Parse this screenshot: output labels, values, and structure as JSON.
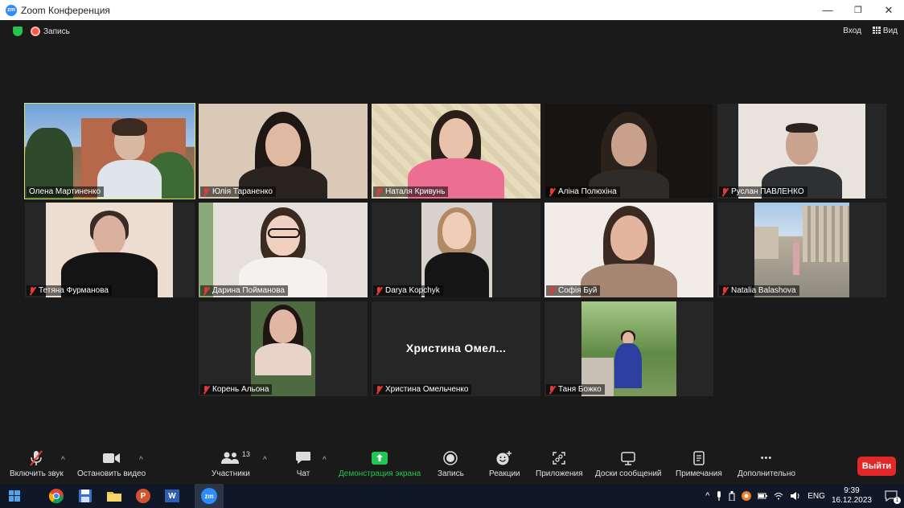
{
  "window": {
    "title": "Zoom Конференция",
    "logo_text": "zm",
    "minimize": "—",
    "restore": "❐",
    "close": "✕"
  },
  "meeting_top": {
    "recording_label": "Запись",
    "signin_label": "Вход",
    "view_label": "Вид"
  },
  "participants": [
    {
      "name": "Олена Мартиненко",
      "muted": false,
      "active": true
    },
    {
      "name": "Юлія Тараненко",
      "muted": true
    },
    {
      "name": "Наталя Кривунь",
      "muted": true
    },
    {
      "name": "Аліна Полюхіна",
      "muted": true
    },
    {
      "name": "Руслан ПАВЛЕНКО",
      "muted": true
    },
    {
      "name": "Тетяна Фурманова",
      "muted": true
    },
    {
      "name": "Дарина Пойманова",
      "muted": true
    },
    {
      "name": "Darya Kopchyk",
      "muted": true
    },
    {
      "name": "Софія Буй",
      "muted": true
    },
    {
      "name": "Natalia Balashova",
      "muted": true
    },
    {
      "name": "Корень Альона",
      "muted": true
    },
    {
      "name": "Христина Омельченко",
      "muted": true,
      "video_off_label": "Христина Омел..."
    },
    {
      "name": "Таня Божко",
      "muted": true
    }
  ],
  "toolbar": {
    "unmute_label": "Включить звук",
    "stop_video_label": "Остановить видео",
    "participants_label": "Участники",
    "participants_count": "13",
    "chat_label": "Чат",
    "share_label": "Демонстрация экрана",
    "record_label": "Запись",
    "reactions_label": "Реакции",
    "apps_label": "Приложения",
    "whiteboards_label": "Доски сообщений",
    "notes_label": "Примечания",
    "more_label": "Дополнительно",
    "more_dots": "•••",
    "leave_label": "Выйти",
    "share_color": "#23c552",
    "leave_color": "#e02828"
  },
  "taskbar": {
    "apps": [
      "windows-start-icon",
      "chrome-icon",
      "save-disk-icon",
      "file-explorer-icon",
      "powerpoint-icon",
      "word-icon",
      "zoom-icon"
    ],
    "lang": "ENG",
    "time": "9:39",
    "date": "16.12.2023",
    "zoom_text": "zm",
    "ppt_text": "P",
    "word_text": "W",
    "notif_count": "1"
  }
}
